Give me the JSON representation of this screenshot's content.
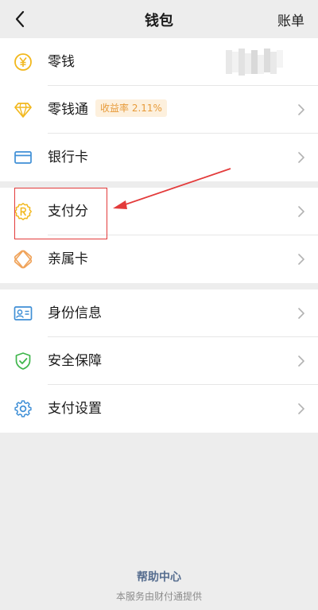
{
  "header": {
    "title": "钱包",
    "right_label": "账单",
    "back_icon": "chevron-left-icon"
  },
  "sections": [
    {
      "items": [
        {
          "label": "零钱",
          "icon": "coin-yen-icon",
          "color": "#f2b81d"
        },
        {
          "label": "零钱通",
          "icon": "diamond-icon",
          "color": "#f2b81d",
          "badge": "收益率 2.11%"
        },
        {
          "label": "银行卡",
          "icon": "bank-card-icon",
          "color": "#3f8fd6"
        }
      ]
    },
    {
      "items": [
        {
          "label": "支付分",
          "icon": "pay-score-badge-icon",
          "color": "#f2b81d"
        },
        {
          "label": "亲属卡",
          "icon": "family-card-icon",
          "color": "#f0a35a"
        }
      ]
    },
    {
      "items": [
        {
          "label": "身份信息",
          "icon": "id-card-icon",
          "color": "#3f8fd6"
        },
        {
          "label": "安全保障",
          "icon": "shield-check-icon",
          "color": "#3fb64b"
        },
        {
          "label": "支付设置",
          "icon": "gear-icon",
          "color": "#3f8fd6"
        }
      ]
    }
  ],
  "annotation": {
    "color": "#e33b3b"
  },
  "footer": {
    "help_link": "帮助中心",
    "provider_note": "本服务由财付通提供"
  }
}
